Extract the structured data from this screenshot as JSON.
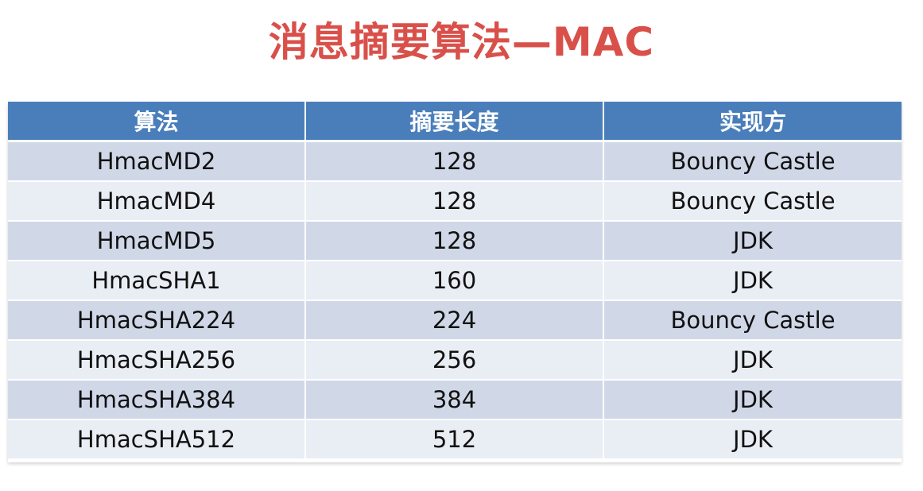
{
  "title": "消息摘要算法—MAC",
  "table": {
    "headers": [
      "算法",
      "摘要长度",
      "实现方"
    ],
    "rows": [
      {
        "algorithm": "HmacMD2",
        "length": "128",
        "provider": "Bouncy Castle"
      },
      {
        "algorithm": "HmacMD4",
        "length": "128",
        "provider": "Bouncy Castle"
      },
      {
        "algorithm": "HmacMD5",
        "length": "128",
        "provider": "JDK"
      },
      {
        "algorithm": "HmacSHA1",
        "length": "160",
        "provider": "JDK"
      },
      {
        "algorithm": "HmacSHA224",
        "length": "224",
        "provider": "Bouncy Castle"
      },
      {
        "algorithm": "HmacSHA256",
        "length": "256",
        "provider": "JDK"
      },
      {
        "algorithm": "HmacSHA384",
        "length": "384",
        "provider": "JDK"
      },
      {
        "algorithm": "HmacSHA512",
        "length": "512",
        "provider": "JDK"
      }
    ]
  },
  "colors": {
    "title": "#d9504a",
    "header_bg": "#4a7ebb",
    "row_odd": "#d0d8e8",
    "row_even": "#e9edf4"
  }
}
